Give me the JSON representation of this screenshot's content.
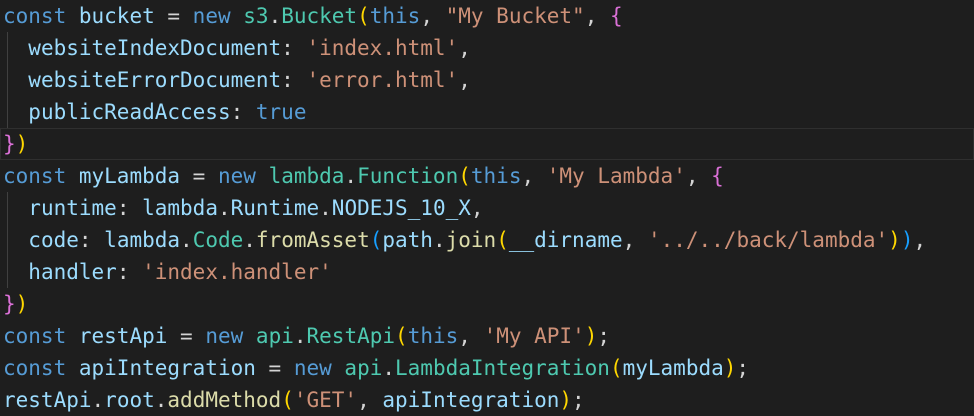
{
  "editor": {
    "lines": [
      {
        "indent": false,
        "tokens": [
          {
            "t": "const",
            "c": "keyword"
          },
          {
            "t": " ",
            "c": "punct"
          },
          {
            "t": "bucket",
            "c": "var"
          },
          {
            "t": " = ",
            "c": "punct"
          },
          {
            "t": "new",
            "c": "keyword"
          },
          {
            "t": " ",
            "c": "punct"
          },
          {
            "t": "s3",
            "c": "class"
          },
          {
            "t": ".",
            "c": "punct"
          },
          {
            "t": "Bucket",
            "c": "class"
          },
          {
            "t": "(",
            "c": "bracket1"
          },
          {
            "t": "this",
            "c": "keyword"
          },
          {
            "t": ", ",
            "c": "punct"
          },
          {
            "t": "\"My Bucket\"",
            "c": "str"
          },
          {
            "t": ", ",
            "c": "punct"
          },
          {
            "t": "{",
            "c": "bracket2"
          }
        ]
      },
      {
        "indent": true,
        "tokens": [
          {
            "t": "  ",
            "c": "punct"
          },
          {
            "t": "websiteIndexDocument",
            "c": "var"
          },
          {
            "t": ": ",
            "c": "punct"
          },
          {
            "t": "'index.html'",
            "c": "str"
          },
          {
            "t": ",",
            "c": "punct"
          }
        ]
      },
      {
        "indent": true,
        "tokens": [
          {
            "t": "  ",
            "c": "punct"
          },
          {
            "t": "websiteErrorDocument",
            "c": "var"
          },
          {
            "t": ": ",
            "c": "punct"
          },
          {
            "t": "'error.html'",
            "c": "str"
          },
          {
            "t": ",",
            "c": "punct"
          }
        ]
      },
      {
        "indent": true,
        "tokens": [
          {
            "t": "  ",
            "c": "punct"
          },
          {
            "t": "publicReadAccess",
            "c": "var"
          },
          {
            "t": ": ",
            "c": "punct"
          },
          {
            "t": "true",
            "c": "keyword"
          }
        ]
      },
      {
        "indent": false,
        "highlight": true,
        "tokens": [
          {
            "t": "}",
            "c": "bracket2"
          },
          {
            "t": ")",
            "c": "bracket1"
          }
        ]
      },
      {
        "indent": false,
        "tokens": [
          {
            "t": "const",
            "c": "keyword"
          },
          {
            "t": " ",
            "c": "punct"
          },
          {
            "t": "myLambda",
            "c": "var"
          },
          {
            "t": " = ",
            "c": "punct"
          },
          {
            "t": "new",
            "c": "keyword"
          },
          {
            "t": " ",
            "c": "punct"
          },
          {
            "t": "lambda",
            "c": "class"
          },
          {
            "t": ".",
            "c": "punct"
          },
          {
            "t": "Function",
            "c": "class"
          },
          {
            "t": "(",
            "c": "bracket1"
          },
          {
            "t": "this",
            "c": "keyword"
          },
          {
            "t": ", ",
            "c": "punct"
          },
          {
            "t": "'My Lambda'",
            "c": "str"
          },
          {
            "t": ", ",
            "c": "punct"
          },
          {
            "t": "{",
            "c": "bracket2"
          }
        ]
      },
      {
        "indent": true,
        "tokens": [
          {
            "t": "  ",
            "c": "punct"
          },
          {
            "t": "runtime",
            "c": "var"
          },
          {
            "t": ": ",
            "c": "punct"
          },
          {
            "t": "lambda",
            "c": "var"
          },
          {
            "t": ".",
            "c": "punct"
          },
          {
            "t": "Runtime",
            "c": "var"
          },
          {
            "t": ".",
            "c": "punct"
          },
          {
            "t": "NODEJS_10_X",
            "c": "var"
          },
          {
            "t": ",",
            "c": "punct"
          }
        ]
      },
      {
        "indent": true,
        "tokens": [
          {
            "t": "  ",
            "c": "punct"
          },
          {
            "t": "code",
            "c": "var"
          },
          {
            "t": ": ",
            "c": "punct"
          },
          {
            "t": "lambda",
            "c": "var"
          },
          {
            "t": ".",
            "c": "punct"
          },
          {
            "t": "Code",
            "c": "class"
          },
          {
            "t": ".",
            "c": "punct"
          },
          {
            "t": "fromAsset",
            "c": "fn"
          },
          {
            "t": "(",
            "c": "bracket3"
          },
          {
            "t": "path",
            "c": "var"
          },
          {
            "t": ".",
            "c": "punct"
          },
          {
            "t": "join",
            "c": "fn"
          },
          {
            "t": "(",
            "c": "bracket1"
          },
          {
            "t": "__dirname",
            "c": "var"
          },
          {
            "t": ", ",
            "c": "punct"
          },
          {
            "t": "'../../back/lambda'",
            "c": "str"
          },
          {
            "t": ")",
            "c": "bracket1"
          },
          {
            "t": ")",
            "c": "bracket3"
          },
          {
            "t": ",",
            "c": "punct"
          }
        ]
      },
      {
        "indent": true,
        "tokens": [
          {
            "t": "  ",
            "c": "punct"
          },
          {
            "t": "handler",
            "c": "var"
          },
          {
            "t": ": ",
            "c": "punct"
          },
          {
            "t": "'index.handler'",
            "c": "str"
          }
        ]
      },
      {
        "indent": false,
        "tokens": [
          {
            "t": "}",
            "c": "bracket2"
          },
          {
            "t": ")",
            "c": "bracket1"
          }
        ]
      },
      {
        "indent": false,
        "tokens": [
          {
            "t": "const",
            "c": "keyword"
          },
          {
            "t": " ",
            "c": "punct"
          },
          {
            "t": "restApi",
            "c": "var"
          },
          {
            "t": " = ",
            "c": "punct"
          },
          {
            "t": "new",
            "c": "keyword"
          },
          {
            "t": " ",
            "c": "punct"
          },
          {
            "t": "api",
            "c": "class"
          },
          {
            "t": ".",
            "c": "punct"
          },
          {
            "t": "RestApi",
            "c": "class"
          },
          {
            "t": "(",
            "c": "bracket1"
          },
          {
            "t": "this",
            "c": "keyword"
          },
          {
            "t": ", ",
            "c": "punct"
          },
          {
            "t": "'My API'",
            "c": "str"
          },
          {
            "t": ")",
            "c": "bracket1"
          },
          {
            "t": ";",
            "c": "punct"
          }
        ]
      },
      {
        "indent": false,
        "tokens": [
          {
            "t": "const",
            "c": "keyword"
          },
          {
            "t": " ",
            "c": "punct"
          },
          {
            "t": "apiIntegration",
            "c": "var"
          },
          {
            "t": " = ",
            "c": "punct"
          },
          {
            "t": "new",
            "c": "keyword"
          },
          {
            "t": " ",
            "c": "punct"
          },
          {
            "t": "api",
            "c": "class"
          },
          {
            "t": ".",
            "c": "punct"
          },
          {
            "t": "LambdaIntegration",
            "c": "class"
          },
          {
            "t": "(",
            "c": "bracket1"
          },
          {
            "t": "myLambda",
            "c": "var"
          },
          {
            "t": ")",
            "c": "bracket1"
          },
          {
            "t": ";",
            "c": "punct"
          }
        ]
      },
      {
        "indent": false,
        "tokens": [
          {
            "t": "restApi",
            "c": "var"
          },
          {
            "t": ".",
            "c": "punct"
          },
          {
            "t": "root",
            "c": "var"
          },
          {
            "t": ".",
            "c": "punct"
          },
          {
            "t": "addMethod",
            "c": "fn"
          },
          {
            "t": "(",
            "c": "bracket1"
          },
          {
            "t": "'GET'",
            "c": "str"
          },
          {
            "t": ", ",
            "c": "punct"
          },
          {
            "t": "apiIntegration",
            "c": "var"
          },
          {
            "t": ")",
            "c": "bracket1"
          },
          {
            "t": ";",
            "c": "punct"
          }
        ]
      }
    ]
  }
}
